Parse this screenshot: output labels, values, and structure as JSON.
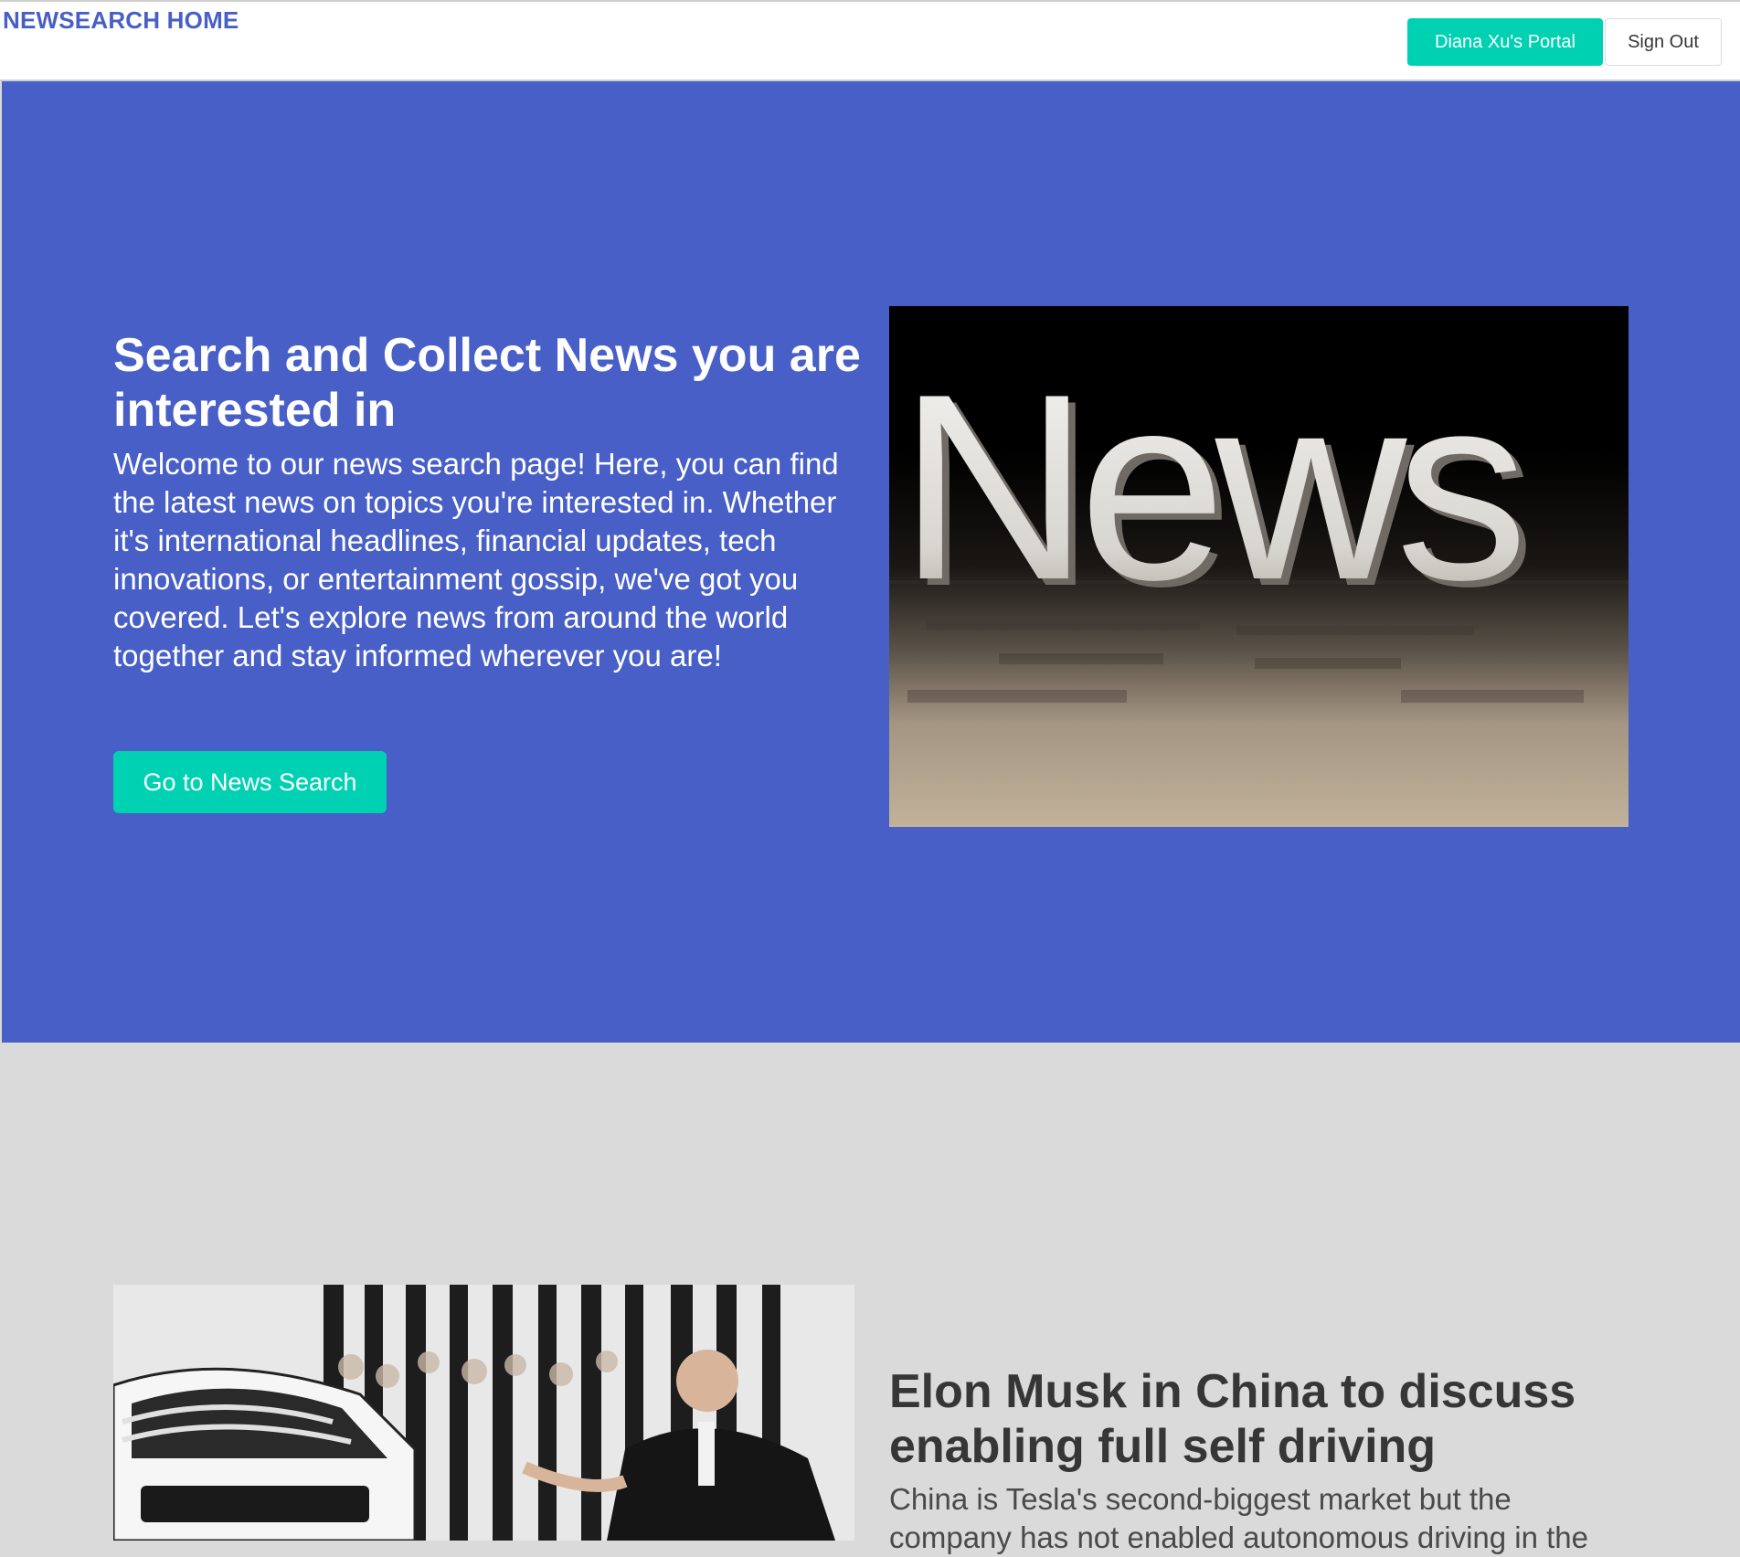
{
  "nav": {
    "brand": "NEWSEARCH HOME",
    "portal_label": "Diana Xu's Portal",
    "signout_label": "Sign Out"
  },
  "hero": {
    "title": "Search and Collect News you are interested in",
    "text": "Welcome to our news search page! Here, you can find the latest news on topics you're interested in. Whether it's international headlines, financial updates, tech innovations, or entertainment gossip, we've got you covered. Let's explore news from around the world together and stay informed wherever you are!",
    "cta_label": "Go to News Search",
    "image_word": "News"
  },
  "article": {
    "title": "Elon Musk in China to discuss enabling full self driving",
    "text": "China is Tesla's second-biggest market but the company has not enabled autonomous driving in the"
  },
  "colors": {
    "brand_blue": "#485fc7",
    "accent_teal": "#00d1b2",
    "page_gray": "#dadada"
  }
}
